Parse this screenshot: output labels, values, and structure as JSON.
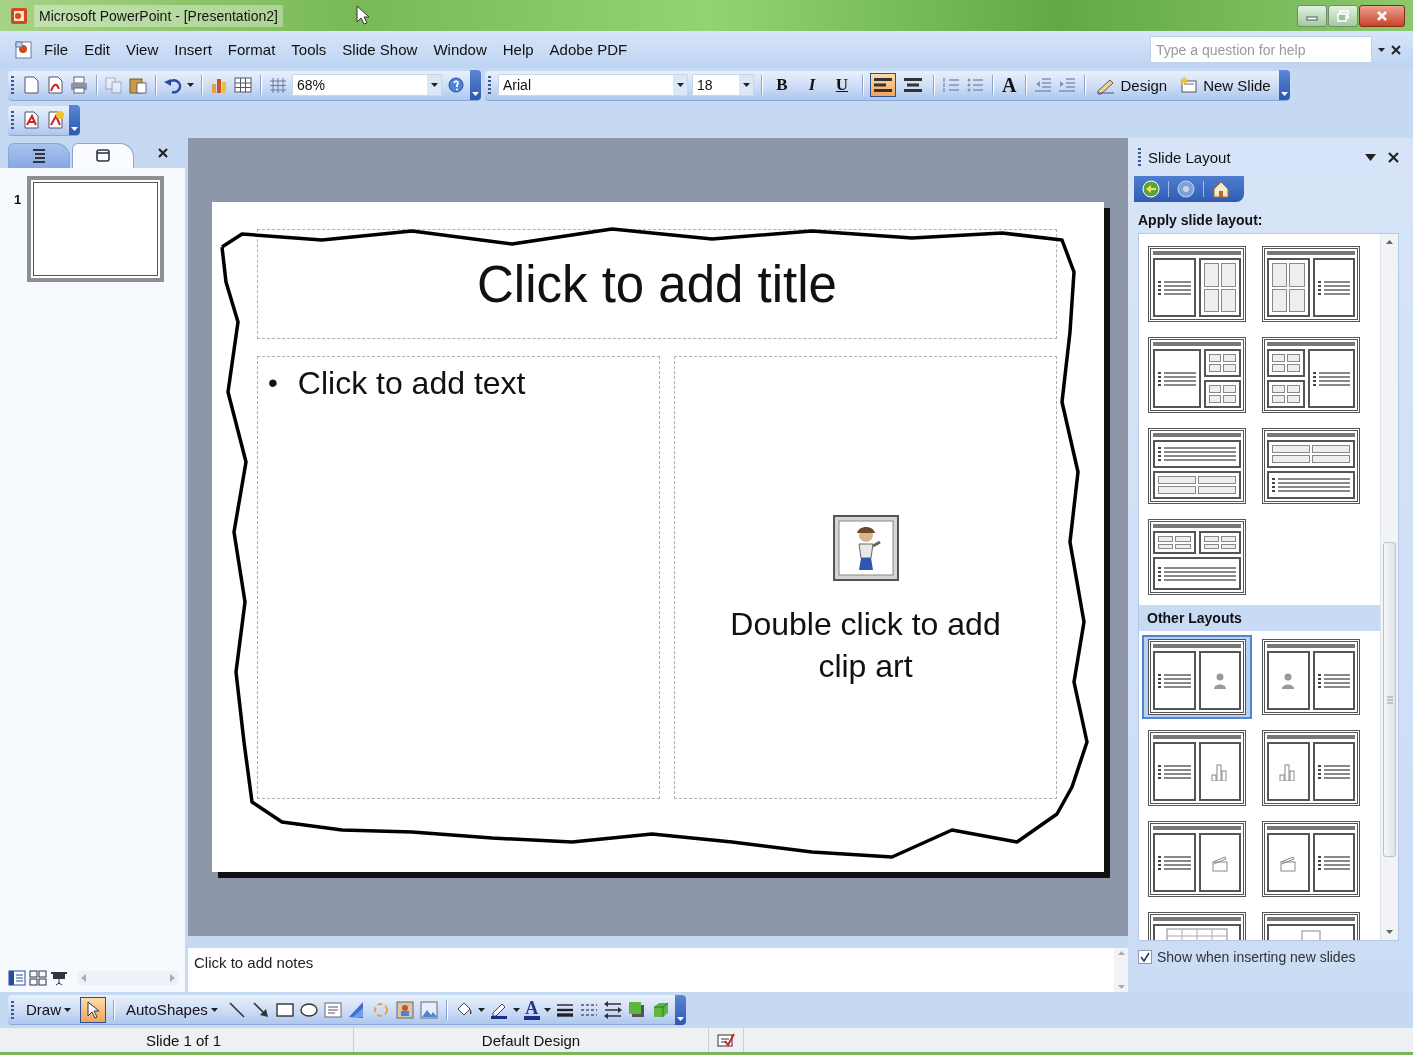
{
  "window": {
    "title": "Microsoft PowerPoint - [Presentation2]"
  },
  "menu_bar": {
    "items": [
      "File",
      "Edit",
      "View",
      "Insert",
      "Format",
      "Tools",
      "Slide Show",
      "Window",
      "Help",
      "Adobe PDF"
    ],
    "help_search": {
      "placeholder": "Type a question for help"
    }
  },
  "formatting_toolbar": {
    "zoom": "68%",
    "font": "Arial",
    "font_size": "18",
    "format_buttons": [
      {
        "label": "B",
        "pressed": false
      },
      {
        "label": "I",
        "pressed": false
      },
      {
        "label": "U",
        "pressed": false
      }
    ],
    "align_buttons": [
      {
        "pressed": true
      },
      {
        "pressed": false
      }
    ],
    "grow_font_glyph": "A",
    "design_button": "Design",
    "new_slide_button": "New Slide"
  },
  "outline_pane": {
    "tabs": [
      {
        "selected": false
      },
      {
        "selected": true
      }
    ],
    "slides": [
      {
        "number": "1",
        "selected": true
      }
    ]
  },
  "slide": {
    "title_prompt": "Click to add title",
    "body_prompt": {
      "bullet": "•",
      "text": "Click to add text"
    },
    "clip_art_prompt": "Double click to add clip art"
  },
  "notes": {
    "prompt": "Click to add notes"
  },
  "task_pane": {
    "title": "Slide Layout",
    "section_label": "Apply slide layout:",
    "layouts": [
      {
        "kind": "text_and_content",
        "selected": false
      },
      {
        "kind": "content_and_text",
        "selected": false
      },
      {
        "kind": "text_and_two_content",
        "selected": false
      },
      {
        "kind": "two_content_and_text",
        "selected": false
      },
      {
        "kind": "text_over_content",
        "selected": false
      },
      {
        "kind": "content_over_text",
        "selected": false
      },
      {
        "kind": "two_content_over_text",
        "selected": false
      }
    ],
    "other_heading": "Other Layouts",
    "other_layouts": [
      {
        "kind": "text_and_clip_art",
        "selected": true
      },
      {
        "kind": "clip_art_and_text",
        "selected": false
      },
      {
        "kind": "text_and_chart",
        "selected": false
      },
      {
        "kind": "chart_and_text",
        "selected": false
      },
      {
        "kind": "text_and_media_clip",
        "selected": false
      },
      {
        "kind": "media_clip_and_text",
        "selected": false
      },
      {
        "kind": "title_and_table",
        "selected": false
      },
      {
        "kind": "title_and_object",
        "selected": false
      }
    ],
    "show_on_insert": {
      "label": "Show when inserting new slides",
      "checked": true
    }
  },
  "drawing_toolbar": {
    "draw_menu": "Draw",
    "select_tool": {
      "pressed": true
    },
    "autoshapes_menu": "AutoShapes",
    "font_color_glyph": "A"
  },
  "status_bar": {
    "slide_position": "Slide 1 of 1",
    "design": "Default Design"
  }
}
